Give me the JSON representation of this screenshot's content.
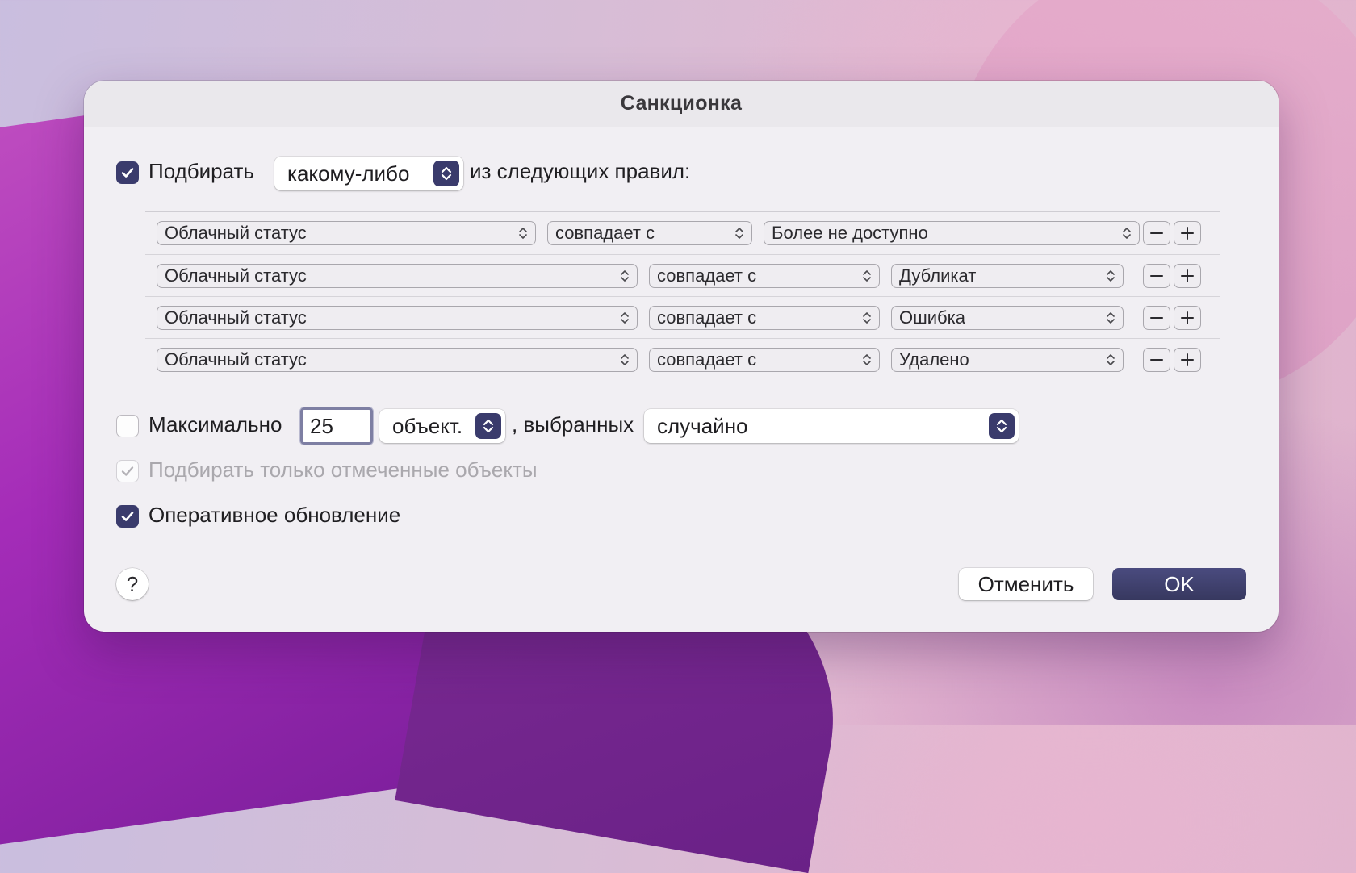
{
  "dialog": {
    "title": "Санкционка"
  },
  "match": {
    "checked": true,
    "label": "Подбирать",
    "mode_value": "какому-либо",
    "suffix": "из следующих правил:"
  },
  "rules": [
    {
      "field": "Облачный статус",
      "operator": "совпадает с",
      "value": "Более не доступно"
    },
    {
      "field": "Облачный статус",
      "operator": "совпадает с",
      "value": "Дубликат"
    },
    {
      "field": "Облачный статус",
      "operator": "совпадает с",
      "value": "Ошибка"
    },
    {
      "field": "Облачный статус",
      "operator": "совпадает с",
      "value": "Удалено"
    }
  ],
  "limit": {
    "checked": false,
    "label": "Максимально",
    "count": "25",
    "unit_value": "объект.",
    "selected_label": ", выбранных",
    "order_value": "случайно"
  },
  "only_checked": {
    "checked": true,
    "disabled": true,
    "label": "Подбирать только отмеченные объекты"
  },
  "live_update": {
    "checked": true,
    "label": "Оперативное обновление"
  },
  "footer": {
    "help_label": "?",
    "cancel_label": "Отменить",
    "ok_label": "OK"
  },
  "colors": {
    "accent": "#3a3b6c",
    "dialog_bg": "#f1eff3"
  }
}
